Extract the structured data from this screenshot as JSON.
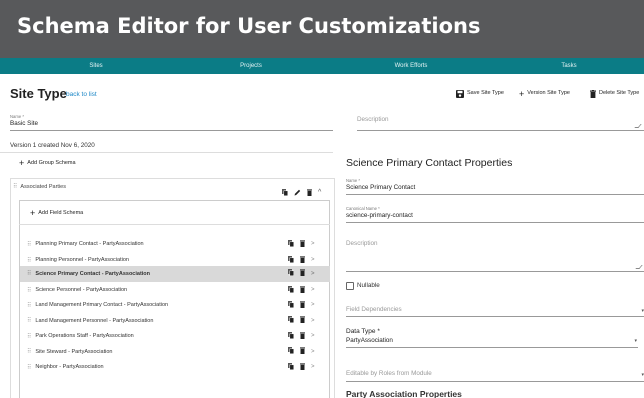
{
  "app": {
    "title": "Schema Editor for User Customizations"
  },
  "nav": {
    "items": [
      "Sites",
      "Projects",
      "Work Efforts",
      "Tasks"
    ]
  },
  "page": {
    "title": "Site Type",
    "back_link": "back to list"
  },
  "toolbar": {
    "save": "Save Site Type",
    "version": "Version Site Type",
    "delete": "Delete Site Type"
  },
  "site_form": {
    "name_label": "Name *",
    "name_value": "Basic Site",
    "description_placeholder": "Description",
    "version_text": "Version 1 created Nov 6, 2020"
  },
  "left": {
    "add_group_label": "Add Group Schema",
    "group_name": "Associated Parties",
    "add_field_label": "Add Field Schema",
    "fields": [
      "Planning Primary Contact - PartyAssociation",
      "Planning Personnel - PartyAssociation",
      "Science Primary Contact - PartyAssociation",
      "Science Personnel - PartyAssociation",
      "Land Management Primary Contact - PartyAssociation",
      "Land Management Personnel - PartyAssociation",
      "Park Operations Staff - PartyAssociation",
      "Site Steward - PartyAssociation",
      "Neighbor - PartyAssociation"
    ],
    "selected_index": 2
  },
  "props": {
    "title": "Science Primary Contact Properties",
    "name_label": "Name *",
    "name_value": "Science Primary Contact",
    "canonical_label": "Canonical Name *",
    "canonical_value": "science-primary-contact",
    "description_placeholder": "Description",
    "nullable_label": "Nullable",
    "field_dependencies_placeholder": "Field Dependencies",
    "data_type_label": "Data Type *",
    "data_type_value": "PartyAssociation",
    "editable_placeholder": "Editable by Roles from Module",
    "next_section_title": "Party Association Properties"
  },
  "icons": {
    "save": "floppy-disk-icon",
    "version": "plus-icon",
    "delete": "trash-icon",
    "copy": "copy-icon",
    "edit": "pencil-icon",
    "chevron_up": "chevron-up-icon",
    "chevron_right": "chevron-right-icon",
    "drag": "drag-handle-icon",
    "dropdown": "caret-down-icon"
  },
  "colors": {
    "banner": "#58595b",
    "nav": "#0b7c86",
    "link": "#1e88c7",
    "selected_row": "#d9d9d9"
  }
}
